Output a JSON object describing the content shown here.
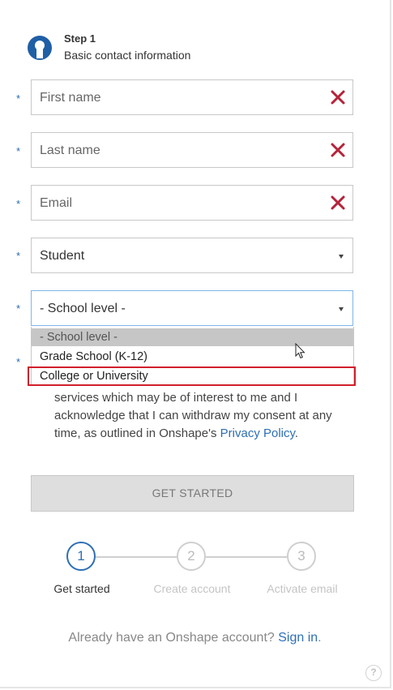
{
  "header": {
    "step_title": "Step 1",
    "step_subtitle": "Basic contact information",
    "logo_icon": "onshape-logo-icon"
  },
  "required_marker": "*",
  "fields": {
    "first_name": {
      "placeholder": "First name",
      "error_icon": "close-icon"
    },
    "last_name": {
      "placeholder": "Last name",
      "error_icon": "close-icon"
    },
    "email": {
      "placeholder": "Email",
      "error_icon": "close-icon"
    },
    "role": {
      "value": "Student"
    },
    "school_level": {
      "value": "- School level -"
    }
  },
  "dropdown": {
    "options": [
      "- School level -",
      "Grade School (K-12)",
      "College or University"
    ],
    "highlighted_option": "College or University"
  },
  "consent": {
    "line1": "services which may be of interest to me and I",
    "line2": "acknowledge that I can withdraw my consent at any",
    "line3_prefix": "time, as outlined in Onshape's ",
    "link": "Privacy Policy",
    "line3_suffix": "."
  },
  "button": {
    "label": "GET STARTED"
  },
  "stepper": [
    {
      "number": "1",
      "label": "Get started",
      "active": true
    },
    {
      "number": "2",
      "label": "Create account",
      "active": false
    },
    {
      "number": "3",
      "label": "Activate email",
      "active": false
    }
  ],
  "signin": {
    "text": "Already have an Onshape account? ",
    "link": "Sign in",
    "suffix": "."
  },
  "help": {
    "label": "?"
  },
  "colors": {
    "accent": "#2d6fb5",
    "error": "#b5233a",
    "highlight_box": "#d11f2c"
  }
}
